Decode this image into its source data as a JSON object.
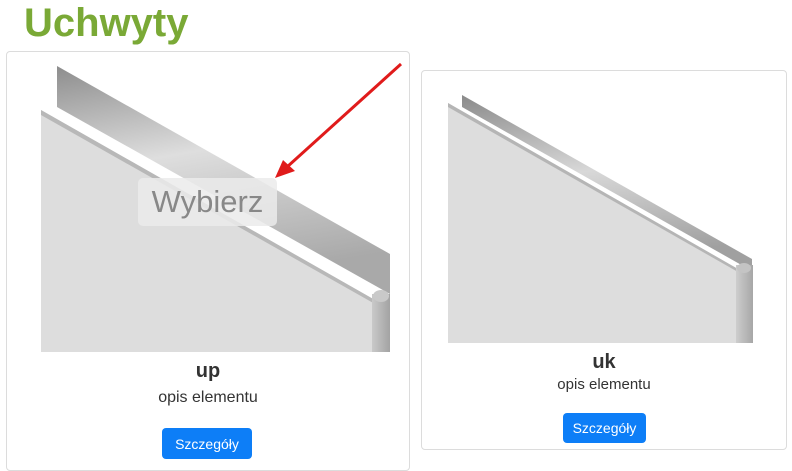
{
  "page": {
    "title": "Uchwyty"
  },
  "cards": [
    {
      "name": "up",
      "description": "opis elementu",
      "button_label": "Szczegóły",
      "overlay_label": "Wybierz"
    },
    {
      "name": "uk",
      "description": "opis elementu",
      "button_label": "Szczegóły"
    }
  ],
  "colors": {
    "title": "#7aa936",
    "button": "#0d7ef7",
    "arrow": "#e01b1b"
  }
}
